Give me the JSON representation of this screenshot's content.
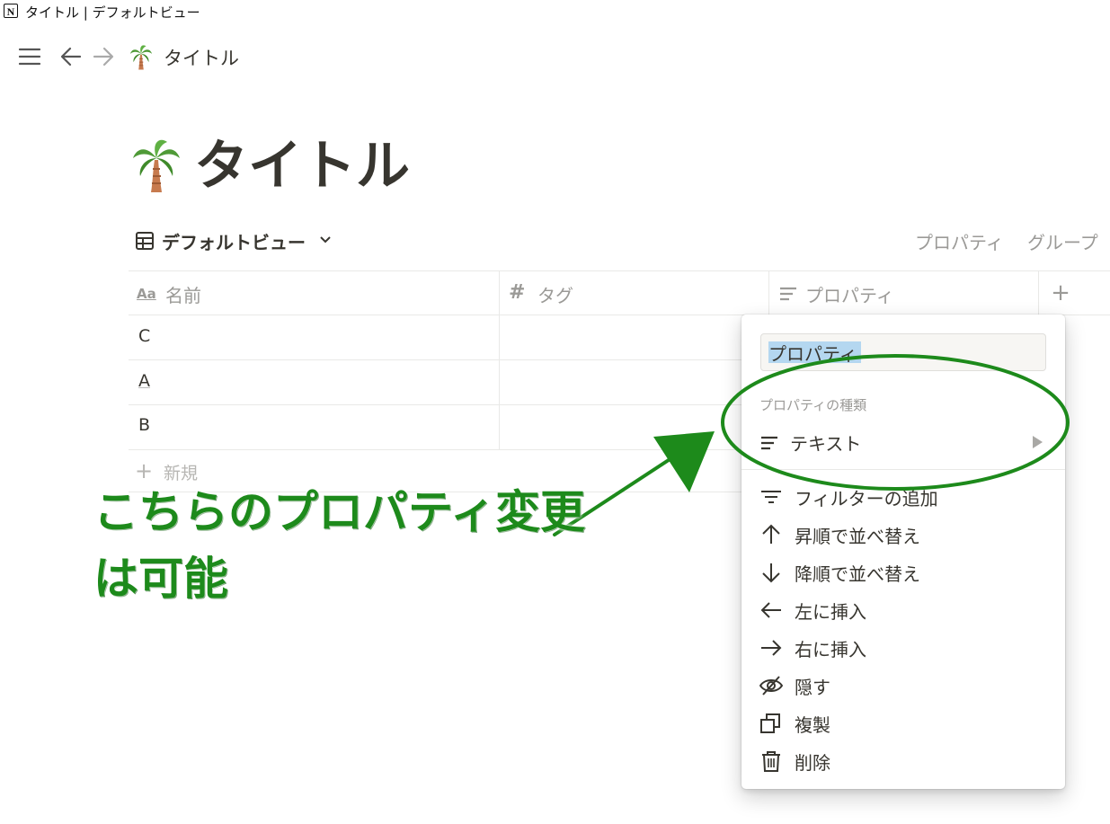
{
  "window": {
    "title": "タイトル | デフォルトビュー",
    "logo_letter": "N"
  },
  "nav": {
    "breadcrumb_title": "タイトル"
  },
  "page": {
    "title": "タイトル",
    "emoji": "palm-tree"
  },
  "view": {
    "name": "デフォルトビュー",
    "property_link": "プロパティ",
    "group_link": "グループ"
  },
  "table": {
    "columns": [
      {
        "label": "名前",
        "icon": "Aa"
      },
      {
        "label": "タグ",
        "icon": "#"
      },
      {
        "label": "プロパティ",
        "icon": "text-lines-icon"
      }
    ],
    "add_column_icon": "+",
    "rows": [
      {
        "name": "C"
      },
      {
        "name": "A"
      },
      {
        "name": "B"
      }
    ],
    "new_row_label": "新規",
    "new_row_icon": "+"
  },
  "property_menu": {
    "name_input_value": "プロパティ",
    "type_section_label": "プロパティの種類",
    "type_value": "テキスト",
    "items": [
      {
        "label": "フィルターの追加",
        "icon": "filter-icon"
      },
      {
        "label": "昇順で並べ替え",
        "icon": "arrow-up-icon"
      },
      {
        "label": "降順で並べ替え",
        "icon": "arrow-down-icon"
      },
      {
        "label": "左に挿入",
        "icon": "arrow-left-icon"
      },
      {
        "label": "右に挿入",
        "icon": "arrow-right-icon"
      },
      {
        "label": "隠す",
        "icon": "eye-off-icon"
      },
      {
        "label": "複製",
        "icon": "duplicate-icon"
      },
      {
        "label": "削除",
        "icon": "trash-icon"
      }
    ]
  },
  "annotation": {
    "line1": "こちらのプロパティ変更",
    "line2": "は可能",
    "color": "#1d8a1b"
  },
  "colors": {
    "text": "#37352f",
    "muted": "#9b9a97",
    "border": "#e9e9e7",
    "selection": "#b4d7f0"
  }
}
